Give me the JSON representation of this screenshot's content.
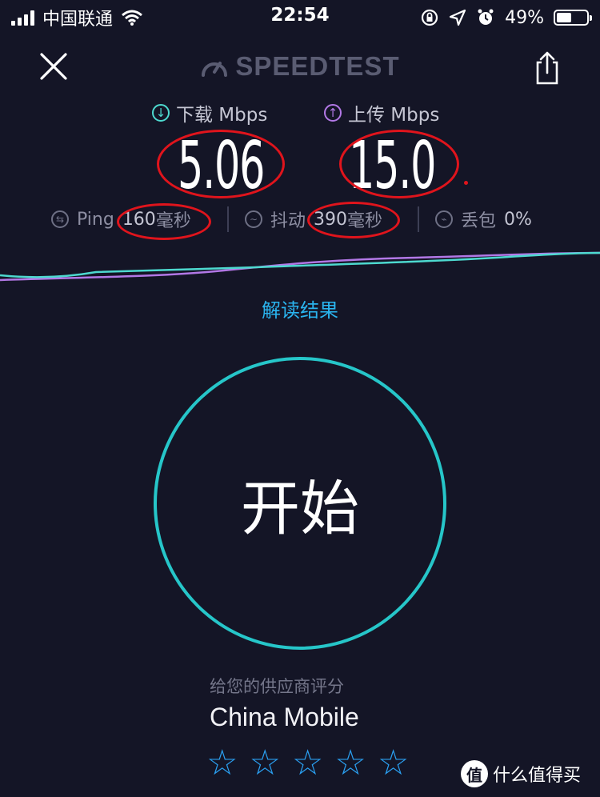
{
  "status_bar": {
    "carrier": "中国联通",
    "time": "22:54",
    "battery_pct": "49%",
    "battery_level": 0.49,
    "icons": [
      "signal-icon",
      "wifi-icon",
      "rotation-lock-icon",
      "location-icon",
      "alarm-icon",
      "battery-icon"
    ]
  },
  "header": {
    "logo": "SPEEDTEST",
    "close_icon": "close-icon",
    "share_icon": "share-icon"
  },
  "metrics": {
    "download": {
      "label": "下载 Mbps",
      "value": "5.06",
      "icon": "download-arrow-icon",
      "color": "#4dd9cf"
    },
    "upload": {
      "label": "上传 Mbps",
      "value": "15.0",
      "icon": "upload-arrow-icon",
      "color": "#b278e6"
    }
  },
  "stats": {
    "ping": {
      "label": "Ping",
      "value": "160",
      "unit": "毫秒"
    },
    "jitter": {
      "label": "抖动",
      "value": "390",
      "unit": "毫秒"
    },
    "loss": {
      "label": "丢包",
      "value": "0%"
    }
  },
  "results_link": "解读结果",
  "start_button": "开始",
  "rating": {
    "prompt": "给您的供应商评分",
    "provider": "China Mobile",
    "stars_total": 5,
    "stars_filled": 0
  },
  "watermark": {
    "badge": "值",
    "text": "什么值得买"
  },
  "colors": {
    "background": "#141526",
    "accent_teal": "#26c6c9",
    "link_blue": "#2ab4ee",
    "annotation_red": "#e0141c"
  }
}
